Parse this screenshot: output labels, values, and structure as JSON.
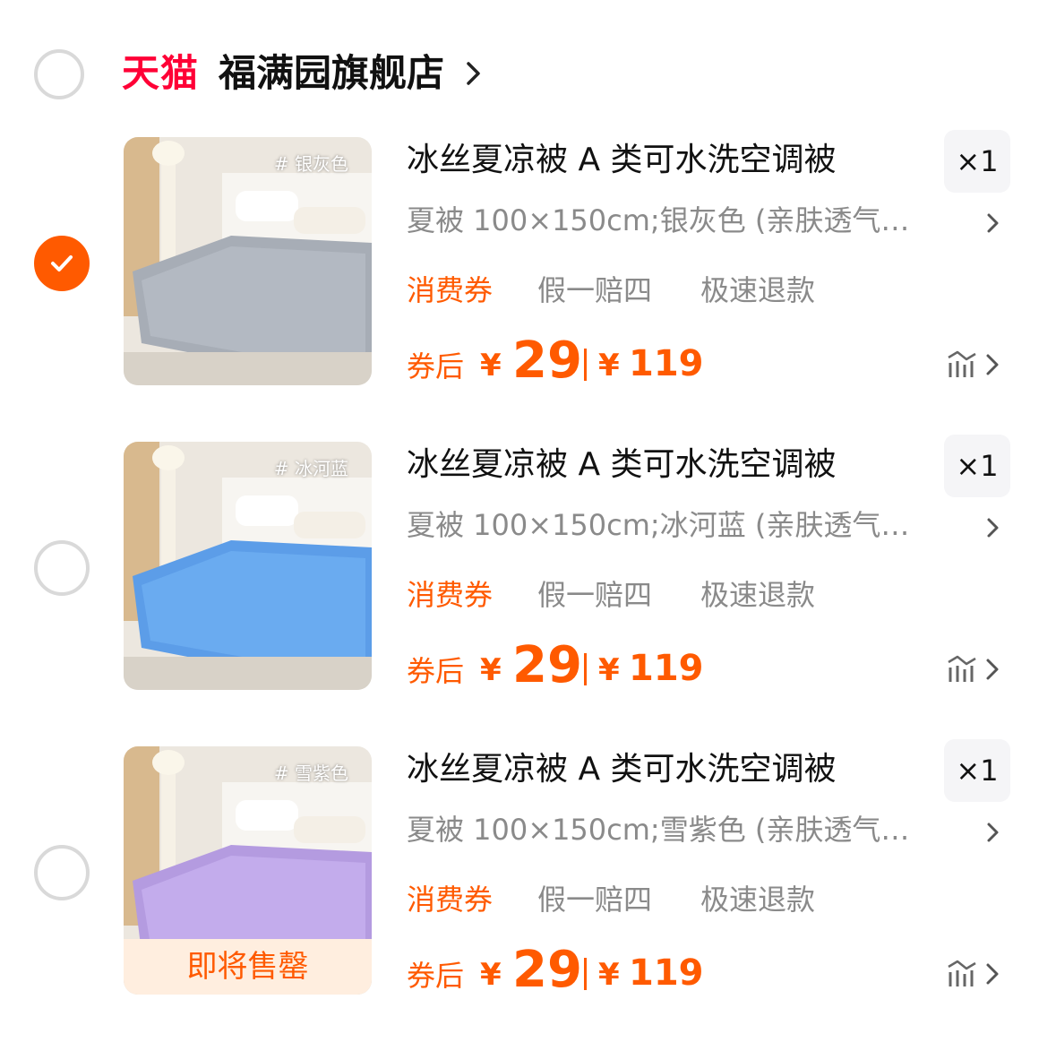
{
  "store": {
    "platform": "天猫",
    "name": "福满园旗舰店",
    "chevron_icon": "chevron-right-icon"
  },
  "colors": {
    "accent": "#ff5a00",
    "tmall_red": "#ff0036",
    "muted_text": "#8a8a8a",
    "unchecked_border": "#d9d9d9"
  },
  "items": [
    {
      "checked": true,
      "image_tag": "# 银灰色",
      "title": "冰丝夏凉被 A 类可水洗空调被",
      "quantity": "×1",
      "sku": "夏被 100×150cm;银灰色 (亲肤透气…",
      "service_tags": [
        "消费券",
        "假一赔四",
        "极速退款"
      ],
      "price_after_label": "券后",
      "currency": "¥",
      "price_after": "29",
      "price_original": "119",
      "sold_out_label": ""
    },
    {
      "checked": false,
      "image_tag": "# 冰河蓝",
      "title": "冰丝夏凉被 A 类可水洗空调被",
      "quantity": "×1",
      "sku": "夏被 100×150cm;冰河蓝 (亲肤透气…",
      "service_tags": [
        "消费券",
        "假一赔四",
        "极速退款"
      ],
      "price_after_label": "券后",
      "currency": "¥",
      "price_after": "29",
      "price_original": "119",
      "sold_out_label": ""
    },
    {
      "checked": false,
      "image_tag": "# 雪紫色",
      "title": "冰丝夏凉被 A 类可水洗空调被",
      "quantity": "×1",
      "sku": "夏被 100×150cm;雪紫色 (亲肤透气…",
      "service_tags": [
        "消费券",
        "假一赔四",
        "极速退款"
      ],
      "price_after_label": "券后",
      "currency": "¥",
      "price_after": "29",
      "price_original": "119",
      "sold_out_label": "即将售罄"
    }
  ]
}
